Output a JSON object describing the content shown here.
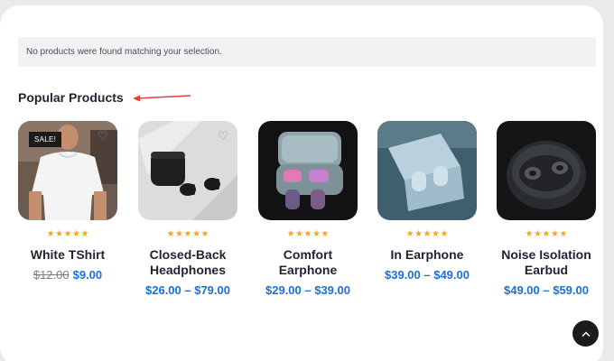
{
  "notice": {
    "text": "No products were found matching your selection."
  },
  "section": {
    "title": "Popular Products"
  },
  "colors": {
    "accent": "#1b6fd6",
    "star": "#f5a623",
    "arrow": "#e0403f"
  },
  "products": [
    {
      "name": "White TShirt",
      "rating": 5,
      "badge": "SALE!",
      "price_old": "$12.00",
      "price": "$9.00"
    },
    {
      "name": "Closed-Back Headphones",
      "rating": 5,
      "price": "$26.00 – $79.00"
    },
    {
      "name": "Comfort Earphone",
      "rating": 5,
      "price": "$29.00 – $39.00"
    },
    {
      "name": "In Earphone",
      "rating": 5,
      "price": "$39.00 – $49.00"
    },
    {
      "name": "Noise Isolation Earbud",
      "rating": 5,
      "price": "$49.00 – $59.00"
    }
  ],
  "icons": {
    "wishlist": "heart-icon",
    "back_to_top": "chevron-up-icon",
    "annotation": "arrow-icon"
  }
}
